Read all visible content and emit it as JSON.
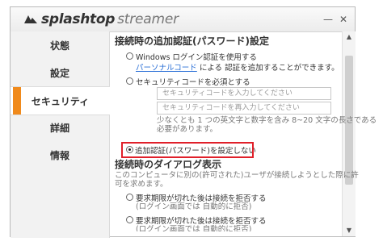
{
  "app": {
    "brand_bold": "splashtop",
    "brand_light": "streamer",
    "minimize": "—",
    "close": "✕"
  },
  "sidebar": {
    "items": [
      {
        "label": "状態"
      },
      {
        "label": "設定"
      },
      {
        "label": "セキュリティ",
        "active": true
      },
      {
        "label": "詳細"
      },
      {
        "label": "情報"
      }
    ]
  },
  "content": {
    "section1_title": "接続時の追加認証(パスワード)設定",
    "opt_windows_label": "Windows ログイン認証を使用する",
    "opt_windows_desc_link": "パーソナルコード",
    "opt_windows_desc_rest": " による 認証を追加することができます。",
    "opt_code_label": "セキュリティコードを必須とする",
    "code_input_placeholder": "セキュリティコードを入力してください",
    "code_confirm_placeholder": "セキュリティコードを再入力してください",
    "code_hint_line1": "少なくとも 1 つの英文字と数字を含み 8~20 文字の長さである",
    "code_hint_line2": "必要があります。",
    "opt_none_label": "追加認証(パスワード)を設定しない",
    "section2_title": "接続時のダイアログ表示",
    "dialog_desc_line1": "このコンピュータに別の(許可された)ユーザが接続しようとした際に許",
    "dialog_desc_line2": "可を求めます。",
    "opt_reject1_label": "要求期限が切れた後は接続を拒否する",
    "opt_reject1_sub": "(ログイン画面では 自動的に拒否)",
    "opt_reject2_label": "要求期限が切れた後は接続を拒否する",
    "opt_reject2_sub": "(ログイン画面では 自動的に拒否)"
  },
  "colors": {
    "accent": "#f08a1c",
    "highlight_border": "#e0202a",
    "link": "#2a6fd6"
  }
}
